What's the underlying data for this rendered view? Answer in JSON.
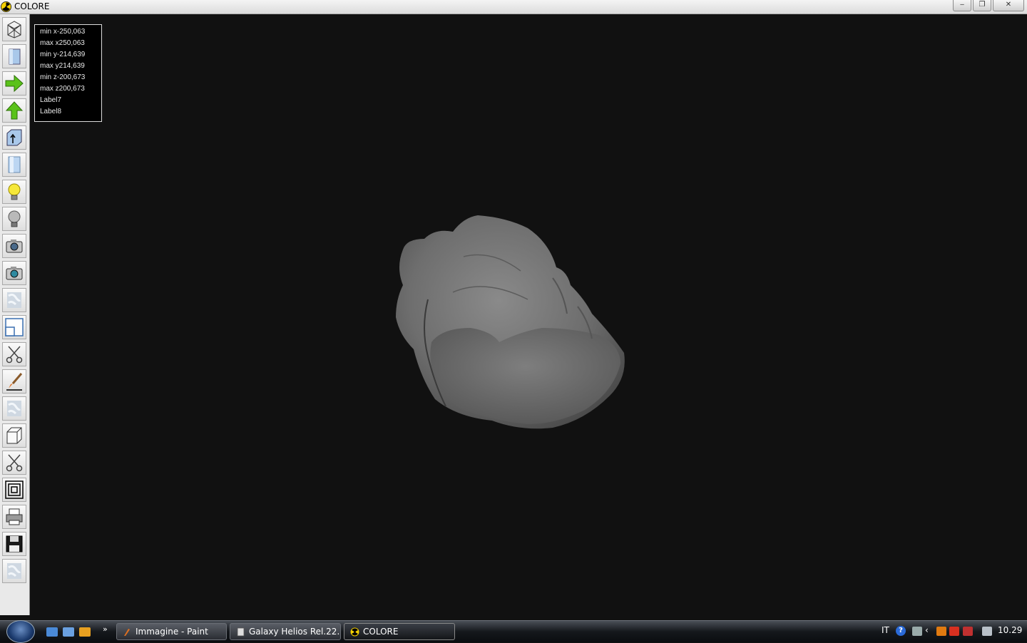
{
  "window": {
    "title": "COLORE",
    "minimize_label": "‒",
    "maximize_label": "❐",
    "close_label": "✕"
  },
  "toolbar": {
    "tools": [
      {
        "name": "wireframe-icon"
      },
      {
        "name": "solid-box-icon"
      },
      {
        "name": "arrow-right-icon"
      },
      {
        "name": "arrow-up-icon"
      },
      {
        "name": "box-arrow-icon"
      },
      {
        "name": "cylinder-icon"
      },
      {
        "name": "light-on-icon"
      },
      {
        "name": "light-off-icon"
      },
      {
        "name": "camera-icon"
      },
      {
        "name": "camera-alt-icon"
      },
      {
        "name": "texture-icon"
      },
      {
        "name": "window-layout-icon"
      },
      {
        "name": "scissors-icon"
      },
      {
        "name": "brush-icon"
      },
      {
        "name": "texture-alt-icon"
      },
      {
        "name": "cube-icon"
      },
      {
        "name": "scissors-alt-icon"
      },
      {
        "name": "concentric-squares-icon"
      },
      {
        "name": "printer-icon"
      },
      {
        "name": "floppy-disk-icon"
      },
      {
        "name": "texture-blank-icon"
      }
    ]
  },
  "info": {
    "min_x": "min x-250,063",
    "max_x": "max x250,063",
    "min_y": "min y-214,639",
    "max_y": "max y214,639",
    "min_z": "min z-200,673",
    "max_z": "max z200,673",
    "label7": "Label7",
    "label8": "Label8"
  },
  "taskbar": {
    "overflow": "»",
    "tasks": [
      {
        "label": "Immagine - Paint"
      },
      {
        "label": "Galaxy Helios  Rel.22..."
      },
      {
        "label": "COLORE"
      }
    ],
    "lang": "IT",
    "help": "?",
    "clock": "10.29"
  }
}
